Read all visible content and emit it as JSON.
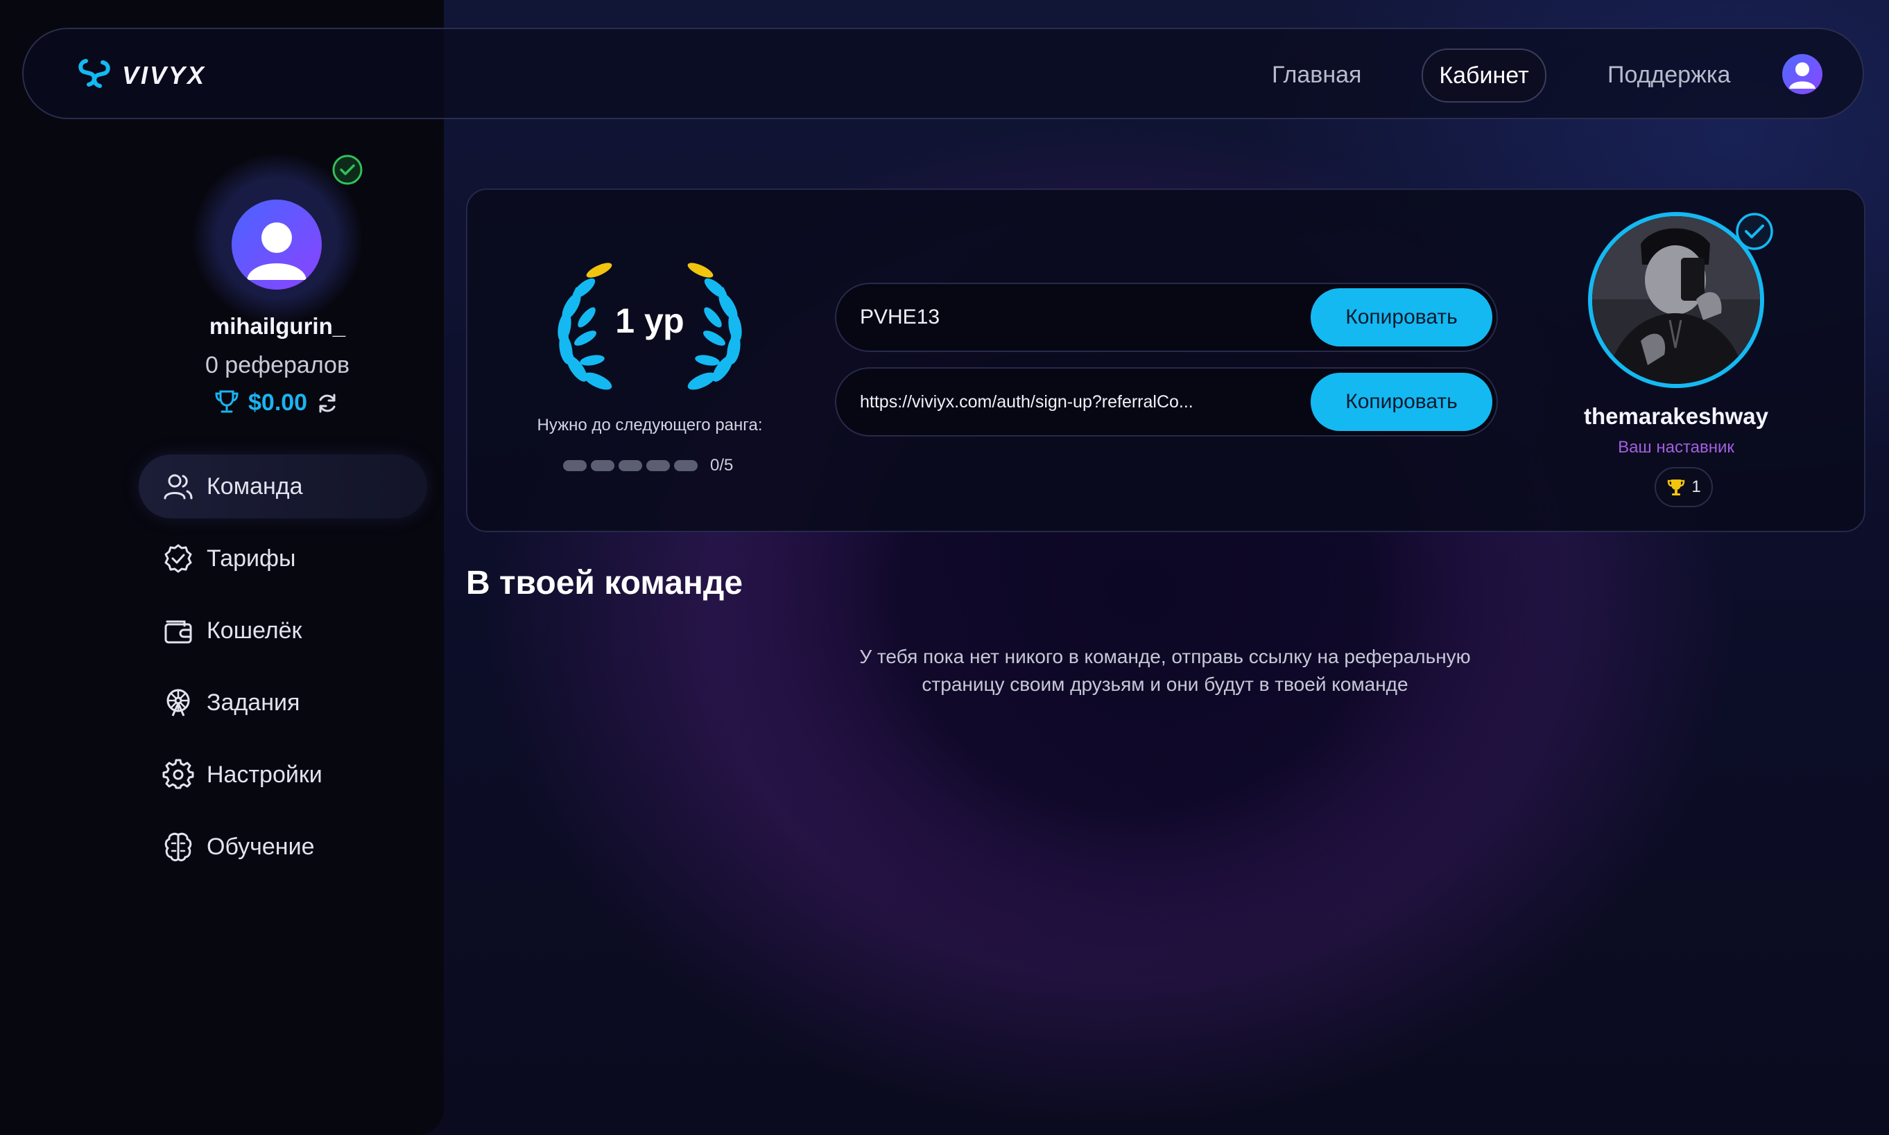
{
  "header": {
    "logo_text": "VIVYX",
    "nav": {
      "home": "Главная",
      "cabinet": "Кабинет",
      "support": "Поддержка"
    }
  },
  "profile": {
    "username": "mihailgurin_",
    "referrals": "0 рефералов",
    "balance": "$0.00"
  },
  "sidebar": {
    "items": [
      {
        "label": "Команда",
        "icon": "team-icon",
        "active": true
      },
      {
        "label": "Тарифы",
        "icon": "badge-check-icon",
        "active": false
      },
      {
        "label": "Кошелёк",
        "icon": "wallet-icon",
        "active": false
      },
      {
        "label": "Задания",
        "icon": "ferris-wheel-icon",
        "active": false
      },
      {
        "label": "Настройки",
        "icon": "gear-icon",
        "active": false
      },
      {
        "label": "Обучение",
        "icon": "brain-icon",
        "active": false
      }
    ]
  },
  "rank": {
    "level": "1 ур",
    "next_rank_label": "Нужно до следующего ранга:",
    "progress_text": "0/5",
    "progress_done": 0,
    "progress_total": 5
  },
  "referral": {
    "code": "PVHE13",
    "link": "https://viviyx.com/auth/sign-up?referralCo...",
    "copy_label": "Копировать"
  },
  "mentor": {
    "name": "themarakeshway",
    "role": "Ваш наставник",
    "trophy_count": "1"
  },
  "team": {
    "title": "В твоей команде",
    "empty_line1": "У тебя пока нет никого в команде, отправь ссылку на реферальную",
    "empty_line2": "страницу своим друзьям и они будут в твоей команде"
  },
  "colors": {
    "accent": "#14b9f2",
    "background": "#0b0c21",
    "sidebar": "#07070f",
    "mentor_role": "#a45fe0",
    "verified_green": "#2fc15a",
    "trophy_gold": "#f1c40f"
  }
}
